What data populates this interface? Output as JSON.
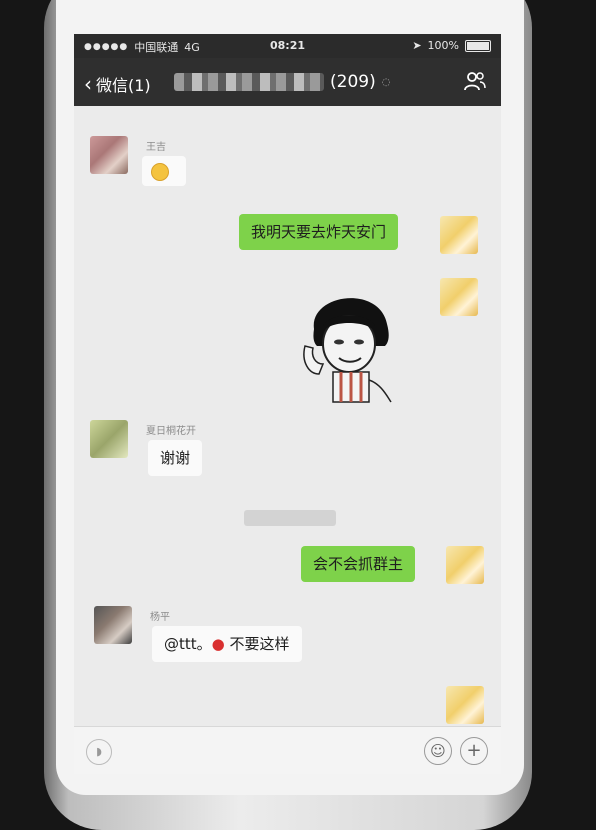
{
  "status_bar": {
    "carrier": "中国联通",
    "network": "4G",
    "time": "08:21",
    "battery": "100%"
  },
  "nav": {
    "back_label": "微信(1)",
    "group_count": "(209)"
  },
  "messages": [
    {
      "side": "left",
      "sender": "王吉",
      "type": "emoji"
    },
    {
      "side": "right",
      "type": "text",
      "text": "我明天要去炸天安门"
    },
    {
      "side": "right",
      "type": "sticker"
    },
    {
      "side": "left",
      "sender": "夏日桐花开",
      "type": "text",
      "text": "谢谢"
    },
    {
      "side": "right",
      "type": "text",
      "text": "会不会抓群主"
    },
    {
      "side": "left",
      "sender": "杨平",
      "type": "text",
      "text_before": "@ttt。",
      "text_after": " 不要这样"
    }
  ],
  "colors": {
    "nav_bg": "#2f2f2f",
    "chat_bg": "#ebebeb",
    "bubble_out": "#7ed24a",
    "bubble_in": "#fafafa"
  },
  "icons": [
    "back-chevron-icon",
    "people-icon",
    "voice-icon",
    "emoji-icon",
    "plus-icon"
  ]
}
